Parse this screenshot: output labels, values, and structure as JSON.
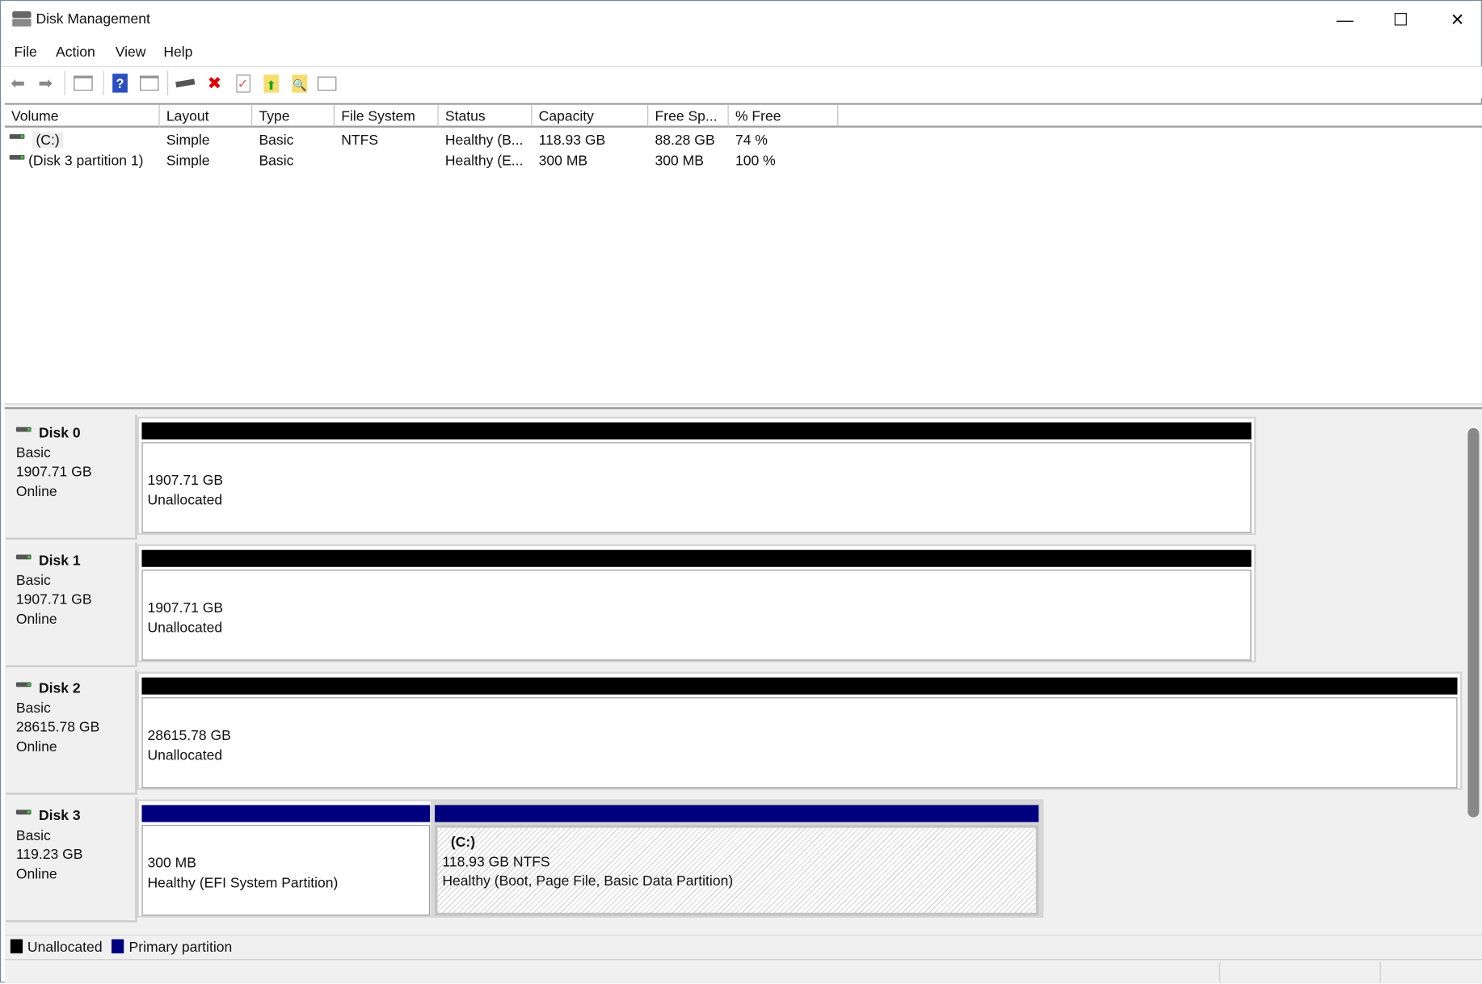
{
  "window": {
    "title": "Disk Management",
    "minimize": "—",
    "maximize": "☐",
    "close": "✕"
  },
  "menu": [
    "File",
    "Action",
    "View",
    "Help"
  ],
  "toolbar": {
    "icons": [
      "back-icon",
      "forward-icon",
      "show-hide-console-tree-icon",
      "help-icon",
      "show-hide-action-pane-icon",
      "connect-disk-icon",
      "delete-icon",
      "properties-icon",
      "export-icon",
      "search-icon",
      "view-settings-icon"
    ]
  },
  "volumes": {
    "columns": [
      "Volume",
      "Layout",
      "Type",
      "File System",
      "Status",
      "Capacity",
      "Free Sp...",
      "% Free"
    ],
    "rows": [
      [
        "(C:)",
        "Simple",
        "Basic",
        "NTFS",
        "Healthy (B...",
        "118.93 GB",
        "88.28 GB",
        "74 %"
      ],
      [
        "(Disk 3 partition 1)",
        "Simple",
        "Basic",
        "",
        "Healthy (E...",
        "300 MB",
        "300 MB",
        "100 %"
      ]
    ]
  },
  "disks": [
    {
      "name": "Disk 0",
      "type": "Basic",
      "size": "1907.71 GB",
      "status": "Online",
      "partitions": [
        {
          "size": "1907.71 GB",
          "desc": "Unallocated"
        }
      ]
    },
    {
      "name": "Disk 1",
      "type": "Basic",
      "size": "1907.71 GB",
      "status": "Online",
      "partitions": [
        {
          "size": "1907.71 GB",
          "desc": "Unallocated"
        }
      ]
    },
    {
      "name": "Disk 2",
      "type": "Basic",
      "size": "28615.78 GB",
      "status": "Online",
      "partitions": [
        {
          "size": "28615.78 GB",
          "desc": "Unallocated"
        }
      ]
    },
    {
      "name": "Disk 3",
      "type": "Basic",
      "size": "119.23 GB",
      "status": "Online",
      "partitions": [
        {
          "size": "300 MB",
          "desc": "Healthy (EFI System Partition)"
        },
        {
          "label": "(C:)",
          "size": "118.93 GB NTFS",
          "desc": "Healthy (Boot, Page File, Basic Data Partition)"
        }
      ]
    }
  ],
  "legend": [
    {
      "label": "Unallocated",
      "color": "#000000"
    },
    {
      "label": "Primary partition",
      "color": "#00007f"
    }
  ]
}
